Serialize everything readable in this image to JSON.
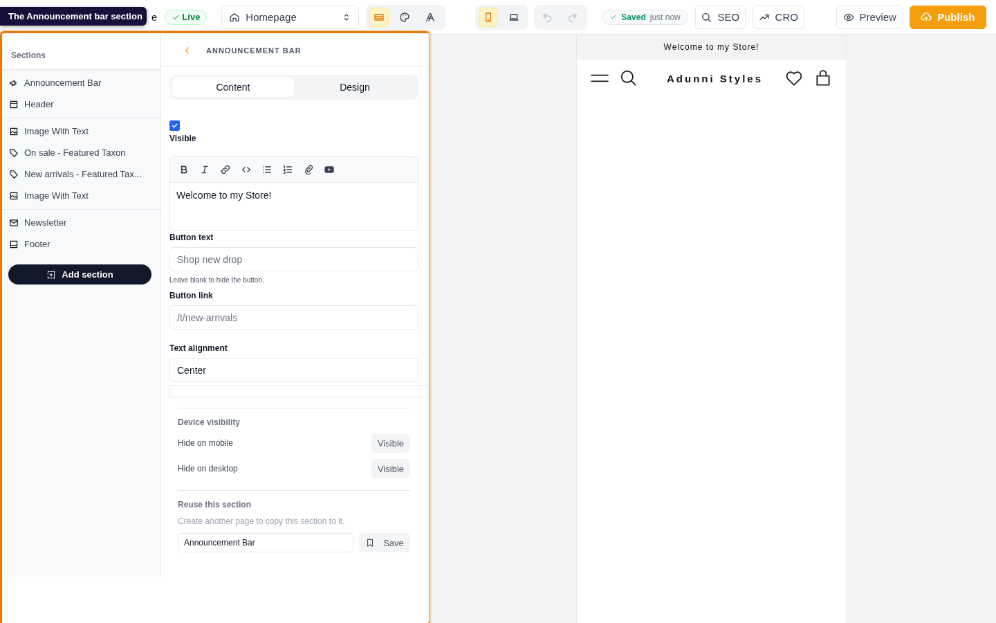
{
  "tooltip": {
    "text": "The Announcement bar section"
  },
  "top_bar": {
    "page_title_fragment": "e",
    "status_badge": "Live",
    "page_select": {
      "value": "Homepage"
    },
    "mode_tools": [
      {
        "kind": "layout",
        "selected": true
      },
      {
        "kind": "palette",
        "selected": false
      },
      {
        "kind": "typography",
        "selected": false
      }
    ],
    "devices": [
      {
        "kind": "mobile",
        "selected": true
      },
      {
        "kind": "desktop",
        "selected": false
      }
    ],
    "history": [
      {
        "kind": "undo",
        "disabled": true
      },
      {
        "kind": "redo",
        "disabled": true
      }
    ],
    "save_status": {
      "label": "Saved",
      "time": "just now"
    },
    "buttons": [
      {
        "kind": "seo",
        "label": "SEO"
      },
      {
        "kind": "cro",
        "label": "CRO"
      },
      {
        "kind": "preview",
        "label": "Preview"
      },
      {
        "kind": "publish",
        "label": "Publish"
      }
    ]
  },
  "sidebar": {
    "title": "Sections",
    "groups": [
      [
        {
          "kind": "megaphone",
          "label": "Announcement Bar"
        },
        {
          "kind": "header",
          "label": "Header"
        }
      ],
      [
        {
          "kind": "image",
          "label": "Image With Text"
        },
        {
          "kind": "tag",
          "label": "On sale - Featured Taxon"
        },
        {
          "kind": "tag",
          "label": "New arrivals - Featured Tax..."
        },
        {
          "kind": "image",
          "label": "Image With Text"
        }
      ],
      [
        {
          "kind": "mail",
          "label": "Newsletter"
        },
        {
          "kind": "footer",
          "label": "Footer"
        }
      ]
    ],
    "add_button": "Add section"
  },
  "panel": {
    "title": "ANNOUNCEMENT BAR",
    "tabs": [
      {
        "label": "Content",
        "selected": true
      },
      {
        "label": "Design",
        "selected": false
      }
    ],
    "visible": {
      "label": "Visible",
      "checked": true
    },
    "editor": {
      "value": "Welcome to my Store!"
    },
    "fields": [
      {
        "label": "Button text",
        "placeholder": "Shop new drop",
        "help": "Leave blank to hide the button."
      },
      {
        "label": "Button link",
        "placeholder": "/t/new-arrivals"
      },
      {
        "label": "Text alignment",
        "value": "Center"
      }
    ],
    "device_visibility": {
      "title": "Device visibility",
      "rows": [
        {
          "label": "Hide on mobile",
          "value": "Visible"
        },
        {
          "label": "Hide on desktop",
          "value": "Visible"
        }
      ]
    },
    "reuse": {
      "title": "Reuse this section",
      "description": "Create another page to copy this section to it.",
      "name_value": "Announcement Bar",
      "save_button": "Save"
    }
  },
  "preview": {
    "announcement": "Welcome to my Store!",
    "store_name": "Adunni Styles"
  }
}
